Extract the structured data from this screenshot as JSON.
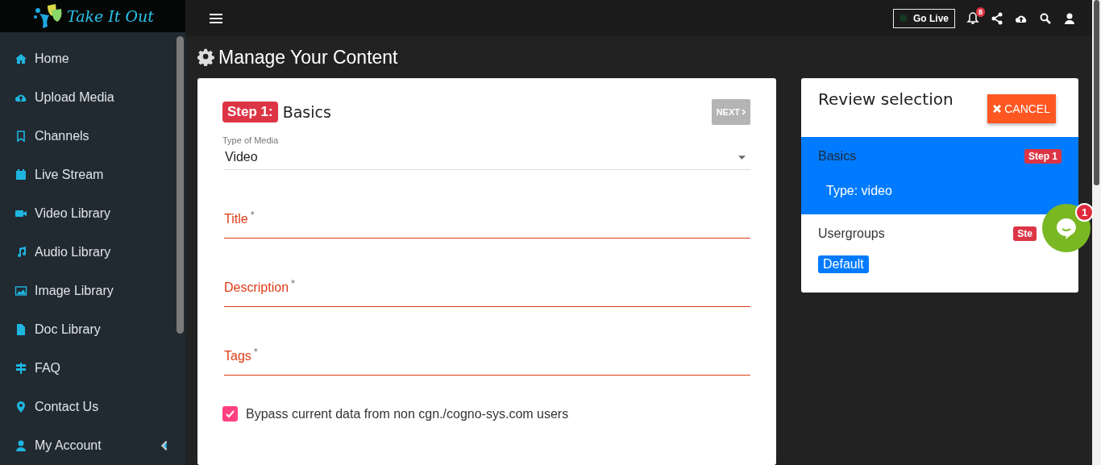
{
  "logo": {
    "text": "Take It Out"
  },
  "sidebar": {
    "items": [
      {
        "label": "Home",
        "selected": false
      },
      {
        "label": "Upload Media",
        "selected": false
      },
      {
        "label": "Channels",
        "selected": false
      },
      {
        "label": "Live Stream",
        "selected": false
      },
      {
        "label": "Video Library",
        "selected": false
      },
      {
        "label": "Audio Library",
        "selected": false
      },
      {
        "label": "Image Library",
        "selected": false
      },
      {
        "label": "Doc Library",
        "selected": false
      },
      {
        "label": "FAQ",
        "selected": false
      },
      {
        "label": "Contact Us",
        "selected": false
      },
      {
        "label": "My Account",
        "selected": false,
        "expanded": false
      }
    ]
  },
  "topbar": {
    "go_live": {
      "label": "Go Live",
      "on": false
    },
    "notifications": "8"
  },
  "page_title": "Manage Your Content",
  "form": {
    "step_badge": "Step 1:",
    "step_title": "Basics",
    "next_button": {
      "label": "NEXT",
      "disabled": true
    },
    "media_type": {
      "label": "Type of Media",
      "value": "Video"
    },
    "fields": [
      {
        "label": "Title",
        "marker": "*"
      },
      {
        "label": "Description",
        "marker": "*"
      },
      {
        "label": "Tags",
        "marker": "*"
      }
    ],
    "bypass": {
      "label": "Bypass current data from non cgn./cogno-sys.com users",
      "checked": true
    }
  },
  "review": {
    "title": "Review selection",
    "cancel": "CANCEL",
    "sections": [
      {
        "name": "Basics",
        "badge": "Step 1",
        "selected": true,
        "detail": "Type: video"
      },
      {
        "name": "Usergroups",
        "badge": "Ste",
        "selected": false,
        "tag": "Default"
      }
    ]
  },
  "chat": {
    "count": "1"
  }
}
